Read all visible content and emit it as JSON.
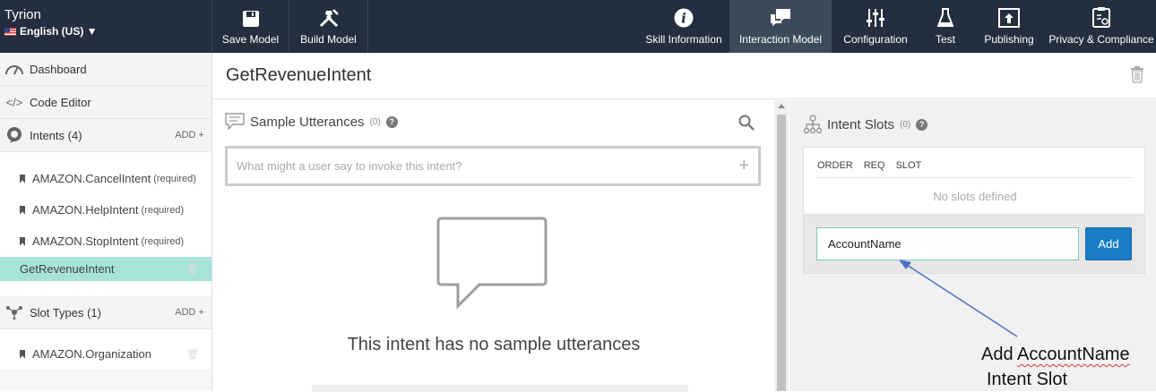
{
  "app": {
    "skill_name": "Tyrion",
    "language": "English (US) ▼"
  },
  "toolbar": {
    "save_model": "Save Model",
    "build_model": "Build Model",
    "skill_information": "Skill Information",
    "interaction_model": "Interaction Model",
    "configuration": "Configuration",
    "test": "Test",
    "publishing": "Publishing",
    "privacy": "Privacy & Compliance"
  },
  "sidebar": {
    "dashboard": "Dashboard",
    "code_editor": "Code Editor",
    "intents_header": "Intents (4)",
    "add_label": "ADD +",
    "intents": [
      {
        "name": "AMAZON.CancelIntent",
        "note": "(required)"
      },
      {
        "name": "AMAZON.HelpIntent",
        "note": "(required)"
      },
      {
        "name": "AMAZON.StopIntent",
        "note": "(required)"
      },
      {
        "name": "GetRevenueIntent",
        "note": ""
      }
    ],
    "slot_types_header": "Slot Types (1)",
    "slot_types": [
      {
        "name": "AMAZON.Organization"
      }
    ]
  },
  "main": {
    "intent_title": "GetRevenueIntent"
  },
  "utterances": {
    "title": "Sample Utterances",
    "count": "(0)",
    "placeholder": "What might a user say to invoke this intent?",
    "empty_message": "This intent has no sample utterances"
  },
  "slots": {
    "title": "Intent Slots",
    "count": "(0)",
    "col_order": "ORDER",
    "col_req": "REQ",
    "col_slot": "SLOT",
    "empty": "No slots defined",
    "input_value": "AccountName",
    "add_button": "Add"
  },
  "annotation": {
    "line1a": "Add",
    "line1b": "AccountName",
    "line2": "Intent Slot"
  },
  "colors": {
    "topbar": "#232f3e",
    "active_intent": "#a7e3d9",
    "add_button": "#1a7ec6",
    "arrow": "#4a72c4"
  }
}
